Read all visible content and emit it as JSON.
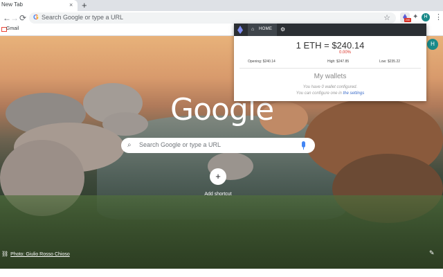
{
  "tab": {
    "title": "New Tab",
    "close": "×",
    "new_tab": "+"
  },
  "toolbar": {
    "back": "←",
    "forward": "→",
    "reload": "⟳",
    "address_placeholder": "Search Google or type a URL",
    "extension_badge": "240",
    "profile_initial": "H",
    "star": "☆",
    "menu": "⋮"
  },
  "bookmarks": {
    "items": [
      {
        "label": "Gmail"
      }
    ]
  },
  "ntp": {
    "logo": "Google",
    "search_placeholder": "Search Google or type a URL",
    "shortcut_plus": "+",
    "shortcut_label": "Add shortcut",
    "credit": "Photo: Giulio Rosso Chioso",
    "profile_initial": "H",
    "apps": "⋮⋮⋮"
  },
  "popup": {
    "nav_home": "HOME",
    "price": "1 ETH = $240.14",
    "change": "0.00%",
    "opening": "Opening: $240.14",
    "high": "High: $247.85",
    "low": "Low: $235.22",
    "wallets_title": "My wallets",
    "wallets_msg1": "You have 0 wallet configured.",
    "wallets_msg2_prefix": "You can configure one in",
    "wallets_msg2_link": "the settings",
    "colors": {
      "nav_bg": "#2b2f33",
      "change": "#d93025",
      "link": "#3b6cc9"
    }
  }
}
